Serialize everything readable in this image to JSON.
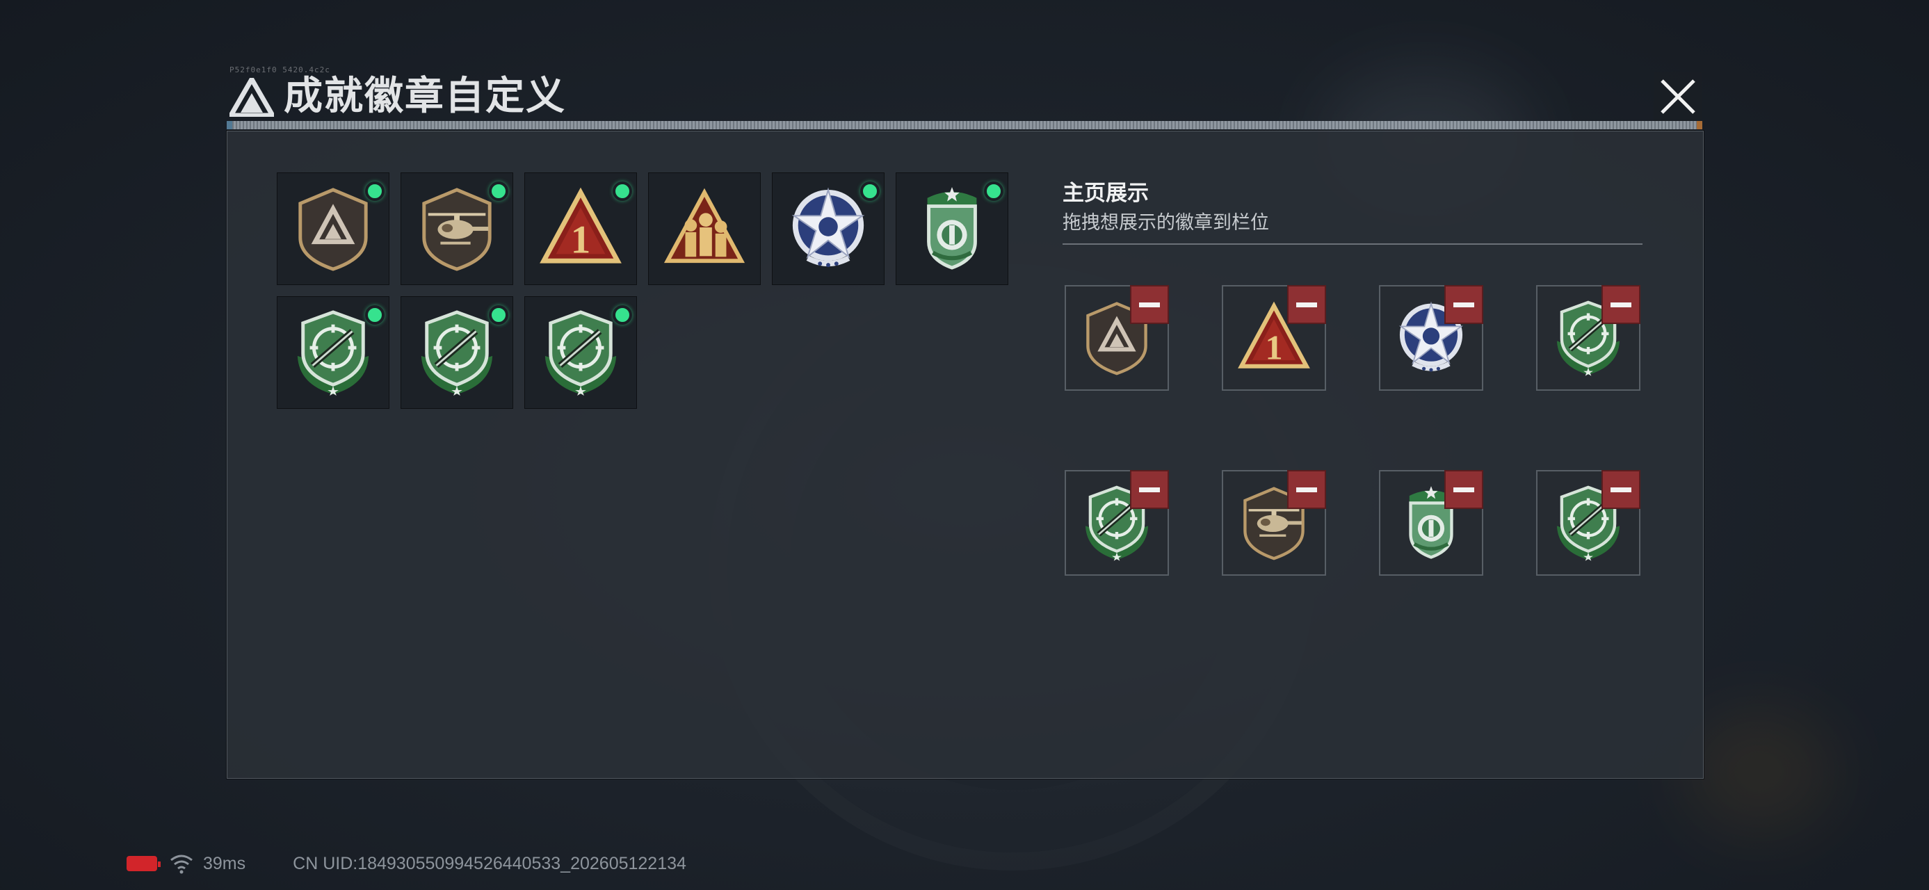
{
  "header": {
    "title": "成就徽章自定义",
    "code": "P52f0e1f0 5420.4c2c"
  },
  "owned_badges": [
    {
      "name": "triangle-emblem-badge",
      "type": "triangle-shield",
      "equipped": true
    },
    {
      "name": "helicopter-badge",
      "type": "helicopter-shield",
      "equipped": true
    },
    {
      "name": "number-one-badge",
      "type": "number-one",
      "equipped": true
    },
    {
      "name": "soldiers-badge",
      "type": "soldiers",
      "equipped": false
    },
    {
      "name": "star-seal-badge",
      "type": "star-seal",
      "equipped": true
    },
    {
      "name": "green-shield-badge",
      "type": "green-shield",
      "equipped": true
    },
    {
      "name": "rifle-crosshair-badge",
      "type": "rifle-crosshair",
      "equipped": true
    },
    {
      "name": "rifle-crosshair-badge",
      "type": "rifle-crosshair",
      "equipped": true
    },
    {
      "name": "rifle-crosshair-badge",
      "type": "rifle-crosshair",
      "equipped": true
    }
  ],
  "showcase": {
    "title": "主页展示",
    "subtitle": "拖拽想展示的徽章到栏位",
    "slots": [
      {
        "type": "triangle-shield"
      },
      {
        "type": "number-one"
      },
      {
        "type": "star-seal"
      },
      {
        "type": "rifle-crosshair"
      },
      {
        "type": "rifle-crosshair"
      },
      {
        "type": "helicopter-shield"
      },
      {
        "type": "green-shield"
      },
      {
        "type": "rifle-crosshair"
      }
    ]
  },
  "status": {
    "ping": "39ms",
    "uid": "CN UID:18493055099452644053 3_202605122134",
    "uid_text": "CN UID:18493055099452644053 3_202605122134"
  },
  "colors": {
    "accent_green": "#36e28e",
    "remove_red": "#8e3033",
    "panel": "#2a3037"
  }
}
